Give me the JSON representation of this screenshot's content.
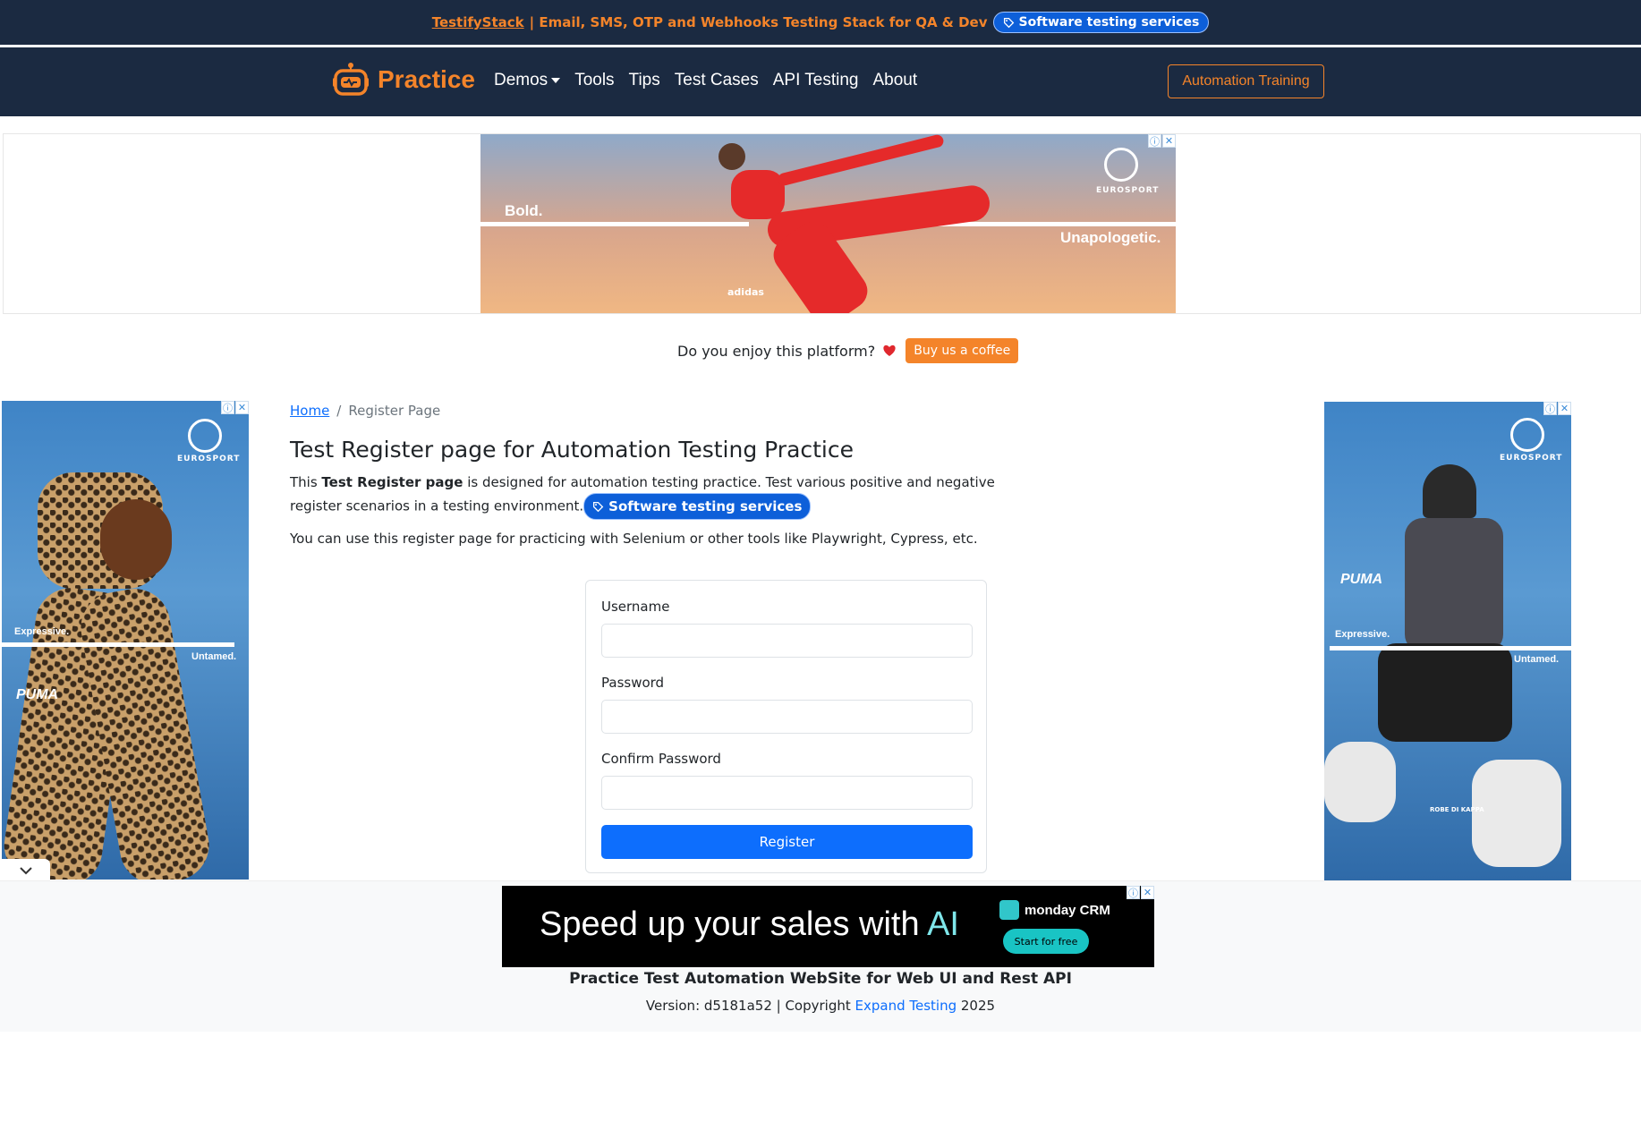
{
  "top_banner": {
    "link_text": "TestifyStack",
    "text": "| Email, SMS, OTP and Webhooks Testing Stack for QA & Dev",
    "pill": "Software testing services"
  },
  "navbar": {
    "brand": "Practice",
    "links": [
      "Demos",
      "Tools",
      "Tips",
      "Test Cases",
      "API Testing",
      "About"
    ],
    "cta": "Automation Training"
  },
  "top_ad": {
    "left_word": "Bold.",
    "right_word": "Unapologetic.",
    "brand": "EUROSPORT",
    "sponsor": "adidas"
  },
  "coffee": {
    "question": "Do you enjoy this platform?",
    "button": "Buy us a coffee"
  },
  "left_ad": {
    "brand": "EUROSPORT",
    "word1": "Expressive.",
    "word2": "Untamed.",
    "sponsor": "PUMA"
  },
  "right_ad": {
    "brand": "EUROSPORT",
    "word1": "Expressive.",
    "word2": "Untamed.",
    "sponsor": "PUMA",
    "sponsor2": "ROBE DI KAPPA"
  },
  "breadcrumb": {
    "home": "Home",
    "separator": "/",
    "current": "Register Page"
  },
  "page": {
    "title": "Test Register page for Automation Testing Practice",
    "desc_prefix": "This ",
    "desc_bold": "Test Register page",
    "desc_suffix": " is designed for automation testing practice. Test various positive and negative register scenarios in a testing environment.",
    "desc_pill": "Software testing services",
    "desc2": "You can use this register page for practicing with Selenium or other tools like Playwright, Cypress, etc."
  },
  "form": {
    "username_label": "Username",
    "password_label": "Password",
    "confirm_label": "Confirm Password",
    "submit": "Register"
  },
  "bottom_ad": {
    "text_main": "Speed up your sales with ",
    "text_ai": "AI",
    "brand": "monday CRM",
    "button": "Start for free"
  },
  "footer": {
    "title": "Practice Test Automation WebSite for Web UI and Rest API",
    "version_prefix": "Version: d5181a52 | Copyright ",
    "link": "Expand Testing",
    "year": " 2025"
  },
  "colors": {
    "navy": "#1b2a41",
    "orange": "#f4842a",
    "primary": "#0d6efd"
  }
}
